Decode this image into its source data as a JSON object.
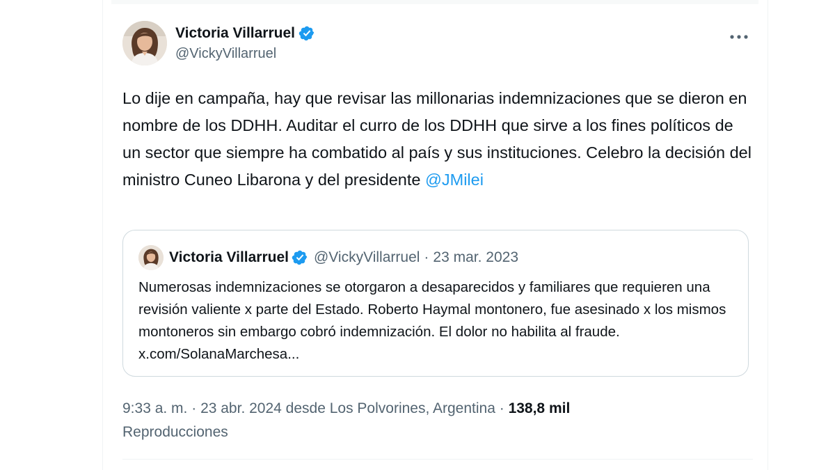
{
  "tweet": {
    "author": {
      "display_name": "Victoria Villarruel",
      "handle": "@VickyVillarruel",
      "verified_icon": "verified-badge-icon"
    },
    "more_icon": "more-horizontal-icon",
    "text": "Lo dije en campaña, hay que revisar las millonarias indemnizaciones que se dieron en nombre de los DDHH. Auditar el curro de los DDHH que sirve a los fines políticos de un sector que siempre ha combatido al país y sus instituciones. Celebro la decisión del ministro Cuneo Libarona y del presidente ",
    "mention": "@JMilei",
    "quote": {
      "display_name": "Victoria Villarruel",
      "handle": "@VickyVillarruel",
      "separator": "·",
      "date": "23 mar. 2023",
      "text": "Numerosas indemnizaciones se otorgaron a desaparecidos y familiares que requieren una revisión valiente x parte del Estado. Roberto Haymal montonero, fue asesinado x los mismos montoneros sin embargo cobró indemnización. El dolor no habilita al fraude. x.com/SolanaMarchesa..."
    },
    "meta": {
      "time": "9:33 a. m.",
      "sep1": " · ",
      "date": "23 abr. 2024",
      "location": " desde Los Polvorines, Argentina",
      "sep2": " · ",
      "views_count": "138,8 mil",
      "views_label": "Reproducciones"
    }
  },
  "colors": {
    "text": "#0f1419",
    "secondary": "#536471",
    "accent": "#1d9bf0",
    "border": "#cfd9de"
  }
}
